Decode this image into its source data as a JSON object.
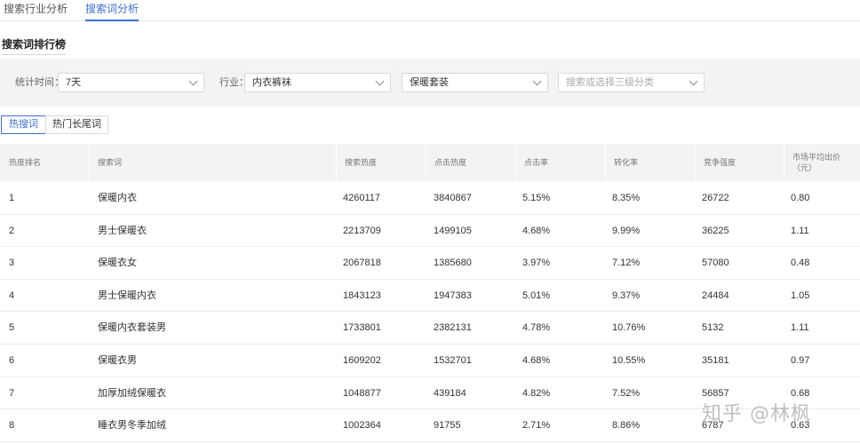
{
  "tabs": [
    {
      "label": "搜索行业分析",
      "active": false
    },
    {
      "label": "搜索词分析",
      "active": true
    }
  ],
  "section_title": "搜索词排行榜",
  "filters": {
    "period_label": "统计时间：",
    "period_value": "7天",
    "industry_label": "行业：",
    "industry_value": "内衣裤袜",
    "category2_value": "保暖套装",
    "category3_placeholder": "搜索或选择三级分类"
  },
  "toggles": [
    {
      "label": "热搜词",
      "active": true
    },
    {
      "label": "热门长尾词",
      "active": false
    }
  ],
  "columns": [
    "热度排名",
    "搜索词",
    "搜索热度",
    "点击热度",
    "点击率",
    "转化率",
    "竞争强度",
    "市场平均出价（元）"
  ],
  "rows": [
    {
      "rank": "1",
      "term": "保暖内衣",
      "search_heat": "4260117",
      "click_heat": "3840867",
      "ctr": "5.15%",
      "cvr": "8.35%",
      "competition": "26722",
      "avg_bid": "0.80"
    },
    {
      "rank": "2",
      "term": "男士保暖衣",
      "search_heat": "2213709",
      "click_heat": "1499105",
      "ctr": "4.68%",
      "cvr": "9.99%",
      "competition": "36225",
      "avg_bid": "1.11"
    },
    {
      "rank": "3",
      "term": "保暖衣女",
      "search_heat": "2067818",
      "click_heat": "1385680",
      "ctr": "3.97%",
      "cvr": "7.12%",
      "competition": "57080",
      "avg_bid": "0.48"
    },
    {
      "rank": "4",
      "term": "男士保暖内衣",
      "search_heat": "1843123",
      "click_heat": "1947383",
      "ctr": "5.01%",
      "cvr": "9.37%",
      "competition": "24484",
      "avg_bid": "1.05"
    },
    {
      "rank": "5",
      "term": "保暖内衣套装男",
      "search_heat": "1733801",
      "click_heat": "2382131",
      "ctr": "4.78%",
      "cvr": "10.76%",
      "competition": "5132",
      "avg_bid": "1.11"
    },
    {
      "rank": "6",
      "term": "保暖衣男",
      "search_heat": "1609202",
      "click_heat": "1532701",
      "ctr": "4.68%",
      "cvr": "10.55%",
      "competition": "35181",
      "avg_bid": "0.97"
    },
    {
      "rank": "7",
      "term": "加厚加绒保暖衣",
      "search_heat": "1048877",
      "click_heat": "439184",
      "ctr": "4.82%",
      "cvr": "7.52%",
      "competition": "56857",
      "avg_bid": "0.68"
    },
    {
      "rank": "8",
      "term": "睡衣男冬季加绒",
      "search_heat": "1002364",
      "click_heat": "91755",
      "ctr": "2.71%",
      "cvr": "8.86%",
      "competition": "6787",
      "avg_bid": "0.63"
    }
  ],
  "watermark": "知乎 @林枫"
}
